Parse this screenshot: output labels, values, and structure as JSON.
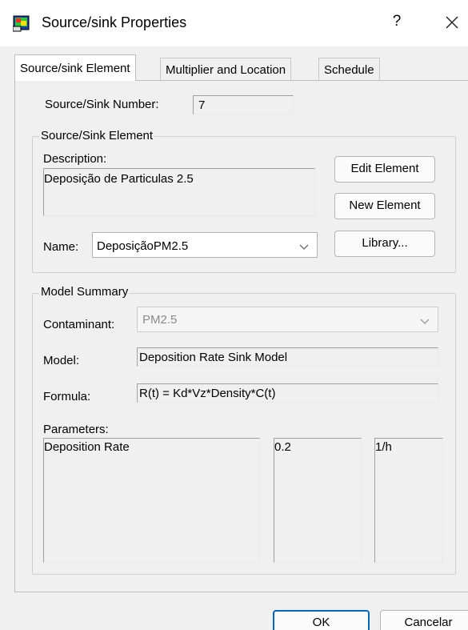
{
  "window": {
    "title": "Source/sink Properties",
    "help_glyph": "?",
    "close_glyph": "✕"
  },
  "tabs": [
    {
      "label": "Source/sink Element",
      "active": true
    },
    {
      "label": "Multiplier and Location",
      "active": false
    },
    {
      "label": "Schedule",
      "active": false
    }
  ],
  "source_sink_number": {
    "label": "Source/Sink Number:",
    "value": "7"
  },
  "element_group": {
    "title": "Source/Sink Element",
    "description_label": "Description:",
    "description_value": "Deposição de Particulas 2.5",
    "name_label": "Name:",
    "name_value": "DeposiçãoPM2.5",
    "edit_button": "Edit Element",
    "new_button": "New Element",
    "library_button": "Library..."
  },
  "model_group": {
    "title": "Model Summary",
    "contaminant_label": "Contaminant:",
    "contaminant_value": "PM2.5",
    "model_label": "Model:",
    "model_value": "Deposition Rate Sink Model",
    "formula_label": "Formula:",
    "formula_value": "R(t) = Kd*Vz*Density*C(t)",
    "parameters_label": "Parameters:",
    "parameters": [
      {
        "name": "Deposition Rate",
        "value": "0.2",
        "unit": "1/h"
      }
    ]
  },
  "footer": {
    "ok_button": "OK",
    "cancel_button": "Cancelar"
  },
  "colors": {
    "dialog_bg": "#f0f0f0",
    "ok_border": "#0067c0",
    "disabled_text": "#8a8a8a"
  }
}
